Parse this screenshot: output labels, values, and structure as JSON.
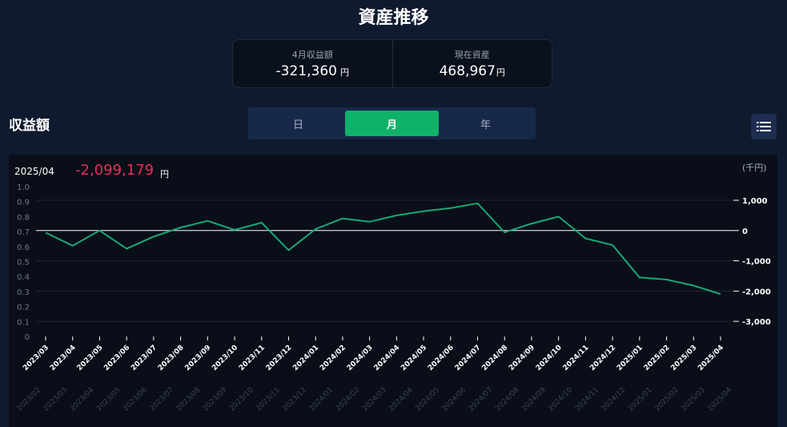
{
  "header": {
    "title": "資産推移"
  },
  "summary": {
    "monthly": {
      "label": "4月収益額",
      "value": "-321,360",
      "unit": "円"
    },
    "current": {
      "label": "現在資産",
      "value": "468,967",
      "unit": "円"
    }
  },
  "section": {
    "title": "収益額"
  },
  "period_tabs": [
    {
      "label": "日",
      "active": false
    },
    {
      "label": "月",
      "active": true
    },
    {
      "label": "年",
      "active": false
    }
  ],
  "list_button": {
    "icon": "list-icon"
  },
  "chart_header": {
    "date": "2025/04",
    "value": "-2,099,179",
    "value_unit": "円",
    "y_unit": "(千円)",
    "value_color": "#e8305a"
  },
  "chart_data": {
    "type": "line",
    "x": [
      "2023/03",
      "2023/04",
      "2023/05",
      "2023/06",
      "2023/07",
      "2023/08",
      "2023/09",
      "2023/10",
      "2023/11",
      "2023/12",
      "2024/01",
      "2024/02",
      "2024/03",
      "2024/04",
      "2024/05",
      "2024/06",
      "2024/07",
      "2024/08",
      "2024/09",
      "2024/10",
      "2024/11",
      "2024/12",
      "2025/01",
      "2025/02",
      "2025/03",
      "2025/04"
    ],
    "series": [
      {
        "color": "#1aa774",
        "values": [
          -70,
          -500,
          0,
          -600,
          -200,
          100,
          320,
          20,
          260,
          -650,
          50,
          400,
          290,
          500,
          640,
          740,
          900,
          -60,
          230,
          460,
          -260,
          -480,
          -1550,
          -1620,
          -1820,
          -2099
        ]
      }
    ],
    "y_right": {
      "ticks": [
        "1,000",
        "0",
        "-1,000",
        "-2,000",
        "-3,000"
      ],
      "tick_values": [
        1000,
        0,
        -1000,
        -2000,
        -3000
      ],
      "range": [
        -3500,
        1450
      ]
    },
    "y_left": {
      "ticks": [
        "1.0",
        "0.9",
        "0.8",
        "0.7",
        "0.6",
        "0.5",
        "0.4",
        "0.3",
        "0.2",
        "0.1",
        "0"
      ]
    },
    "x_ghost_labels": [
      "2023/02",
      "2023/03",
      "2023/04",
      "2023/05",
      "2023/06",
      "2023/07",
      "2023/08",
      "2023/09",
      "2023/10",
      "2023/11",
      "2023/12",
      "2024/01",
      "2024/02",
      "2024/03",
      "2024/04",
      "2024/05",
      "2024/06",
      "2024/07",
      "2024/08",
      "2024/09",
      "2024/10",
      "2024/11",
      "2024/12",
      "2025/01",
      "2025/02",
      "2025/03",
      "2025/04"
    ],
    "grid": true,
    "legend": "none"
  }
}
